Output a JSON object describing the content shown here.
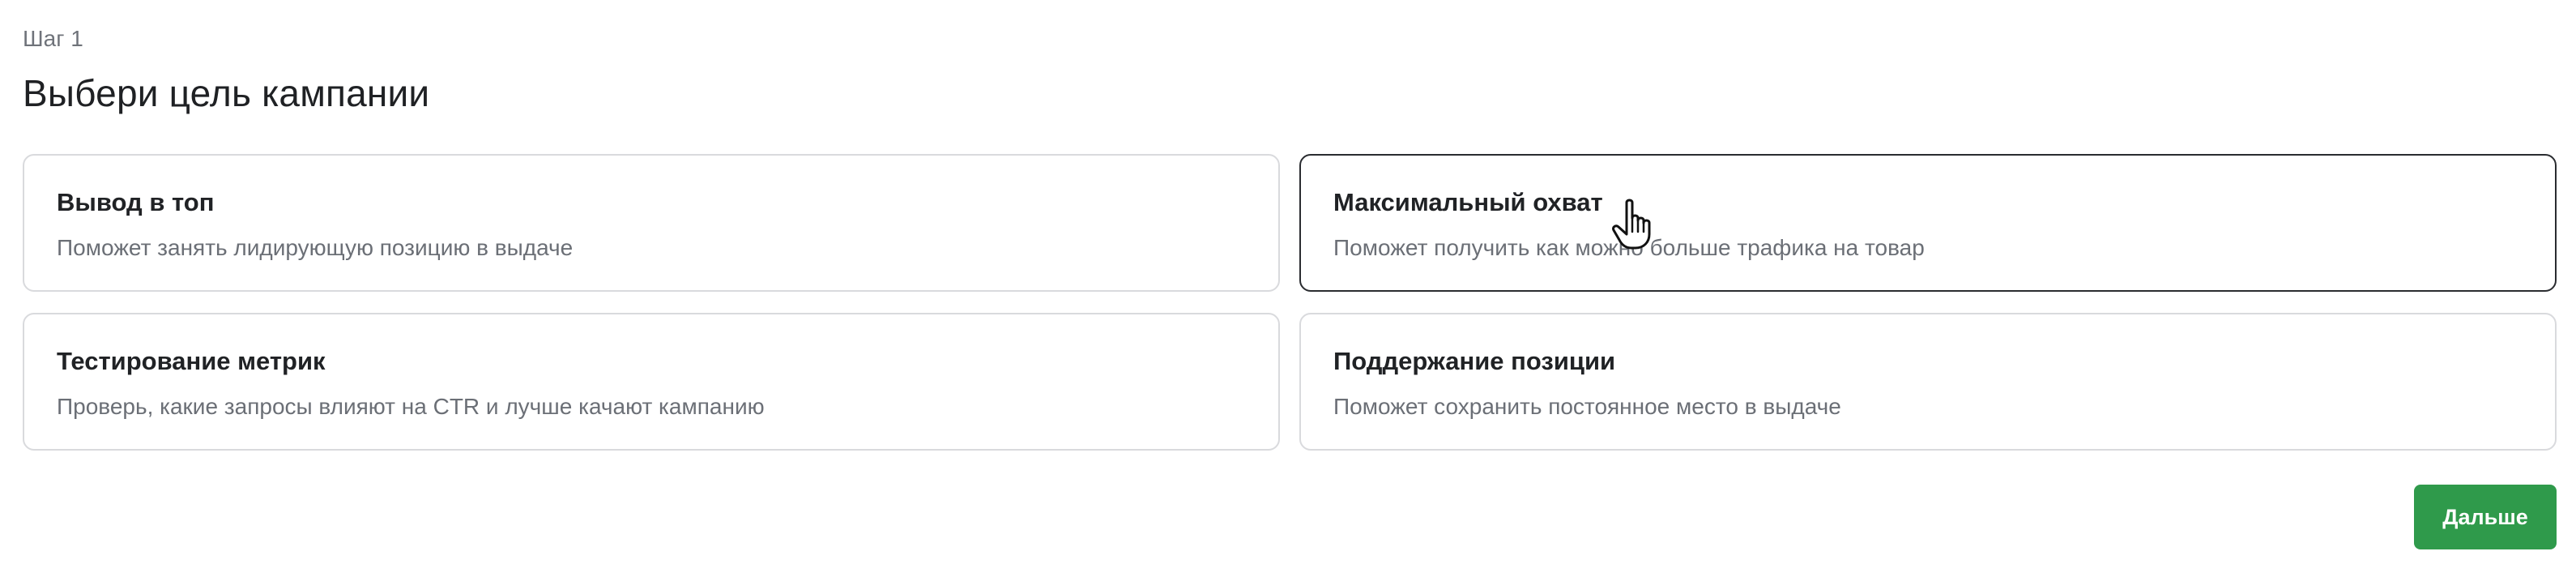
{
  "step": {
    "label": "Шаг 1"
  },
  "page": {
    "title": "Выбери цель кампании"
  },
  "goals": [
    {
      "title": "Вывод в топ",
      "description": "Поможет занять лидирующую позицию в выдаче",
      "selected": false
    },
    {
      "title": "Максимальный охват",
      "description": "Поможет получить как можно больше трафика на товар",
      "selected": true
    },
    {
      "title": "Тестирование метрик",
      "description": "Проверь, какие запросы влияют на CTR и лучше качают кампанию",
      "selected": false
    },
    {
      "title": "Поддержание позиции",
      "description": "Поможет сохранить постоянное место в выдаче",
      "selected": false
    }
  ],
  "actions": {
    "next_label": "Дальше"
  },
  "colors": {
    "primary_green": "#2f9a4b",
    "selected_border": "#2a2c30",
    "card_border": "#d9dadd"
  },
  "icons": {
    "cursor": "hand-pointer-icon"
  }
}
